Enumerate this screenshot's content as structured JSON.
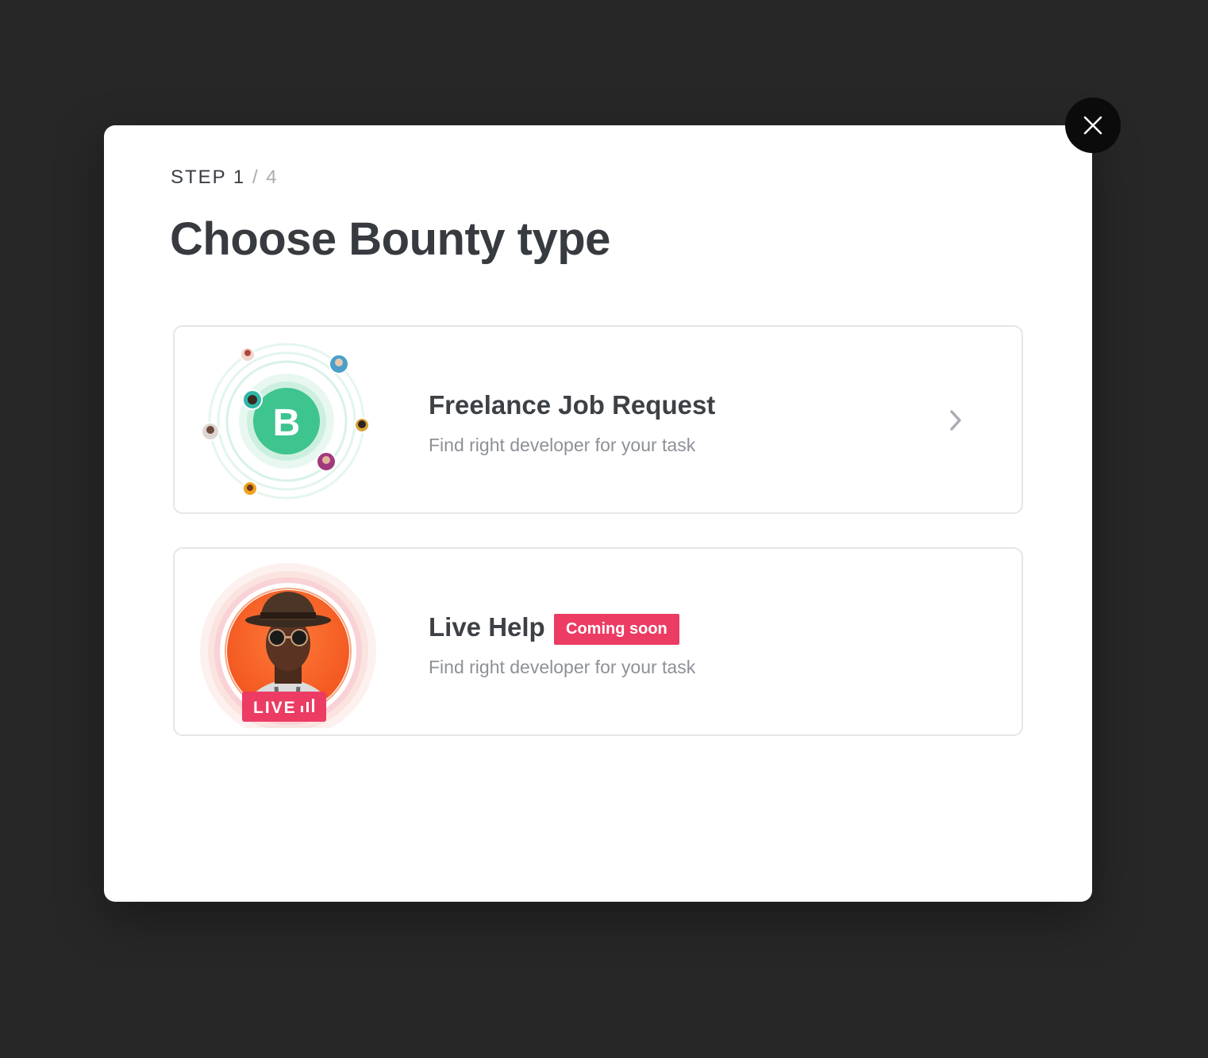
{
  "modal": {
    "step_label": "STEP 1",
    "step_total": "/ 4",
    "title": "Choose Bounty type",
    "close_icon": "close-icon"
  },
  "options": [
    {
      "title": "Freelance Job Request",
      "description": "Find right developer for your task",
      "illustration_letter": "B",
      "chevron_icon": "chevron-right-icon",
      "accent_color": "#3ec48f"
    },
    {
      "title": "Live Help",
      "badge": "Coming soon",
      "description": "Find right developer for your task",
      "live_label": "LIVE",
      "accent_color": "#ec3c63"
    }
  ],
  "colors": {
    "backdrop": "#272727",
    "modal_bg": "#ffffff",
    "title": "#373b40",
    "muted": "#8d9197",
    "green": "#3ec48f",
    "pink": "#ec3c63"
  }
}
